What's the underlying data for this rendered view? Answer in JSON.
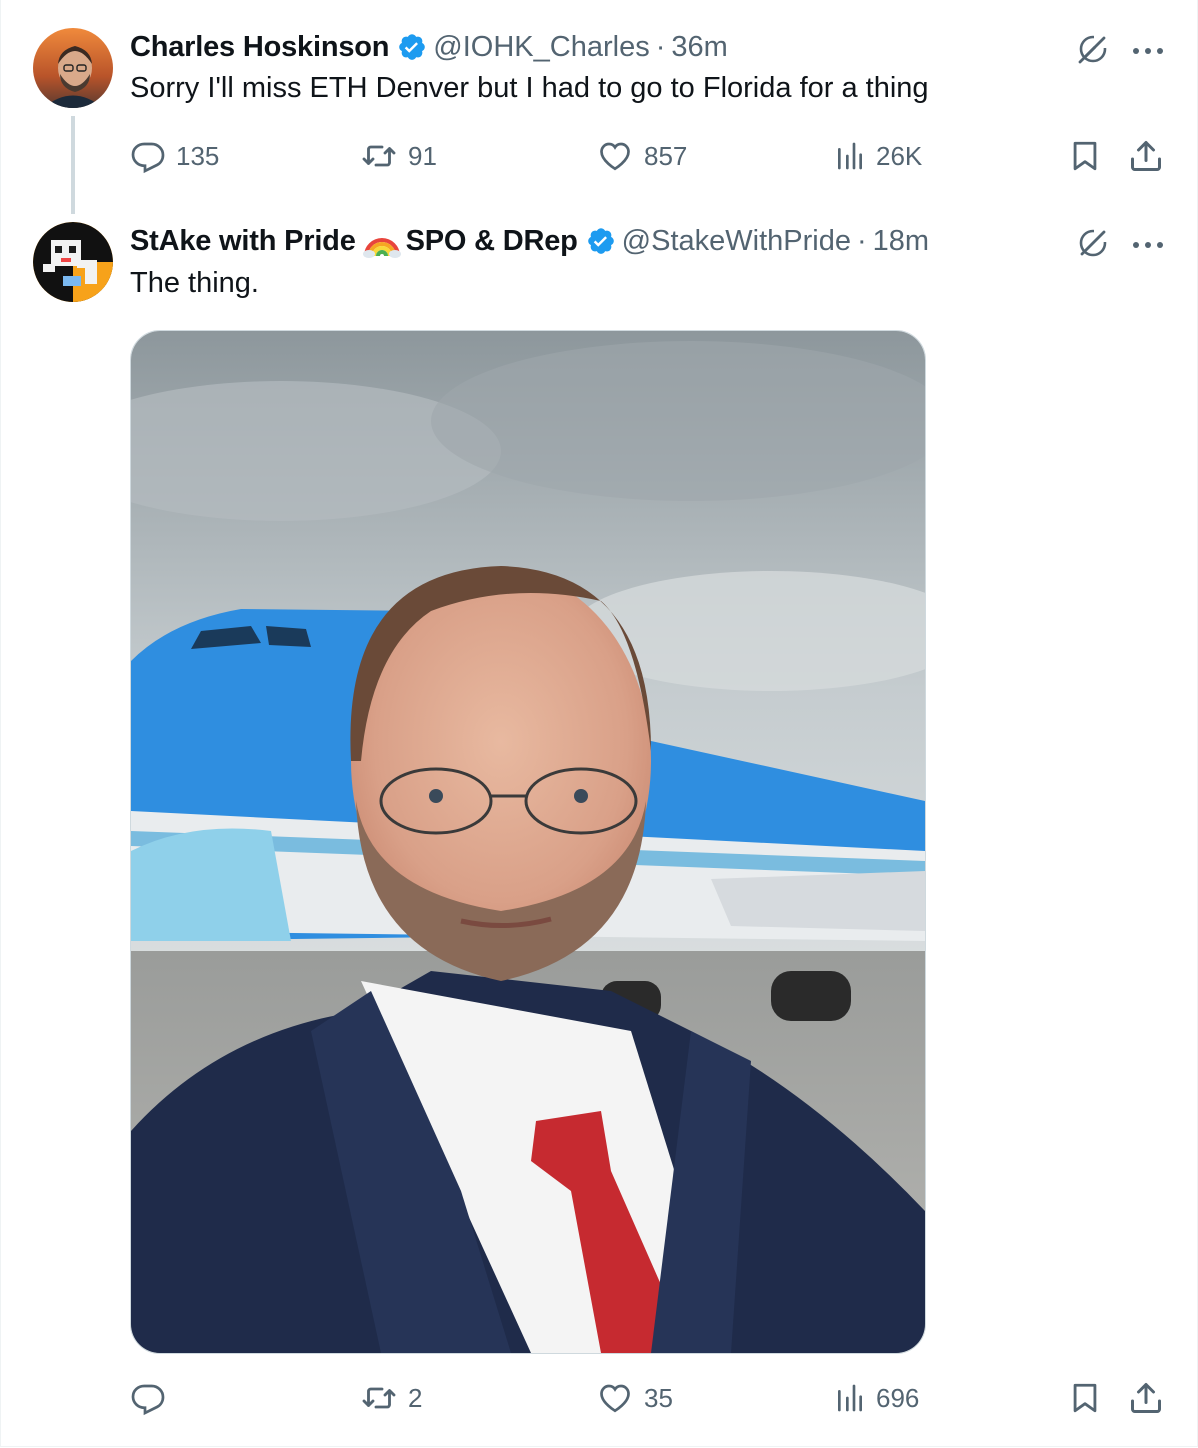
{
  "tweets": [
    {
      "name": "Charles Hoskinson",
      "handle": "@IOHK_Charles",
      "time": "36m",
      "text": "Sorry I'll miss ETH Denver but I had to go to Florida for a thing",
      "stats": {
        "replies": "135",
        "reposts": "91",
        "likes": "857",
        "views": "26K"
      }
    },
    {
      "name": "StAke with Pride",
      "name_suffix": "SPO & DRep",
      "handle": "@StakeWithPride",
      "time": "18m",
      "text": "The thing.",
      "stats": {
        "replies": "",
        "reposts": "2",
        "likes": "35",
        "views": "696"
      }
    }
  ],
  "separator": "·",
  "icons": {
    "verified": "verified-badge-icon",
    "grok": "grok-icon",
    "more": "more-icon",
    "reply": "reply-icon",
    "repost": "repost-icon",
    "like": "like-icon",
    "views": "views-icon",
    "bookmark": "bookmark-icon",
    "share": "share-icon",
    "rainbow": "rainbow-emoji"
  },
  "colors": {
    "accent": "#1d9bf0",
    "muted": "#536471",
    "text": "#0f1419"
  }
}
